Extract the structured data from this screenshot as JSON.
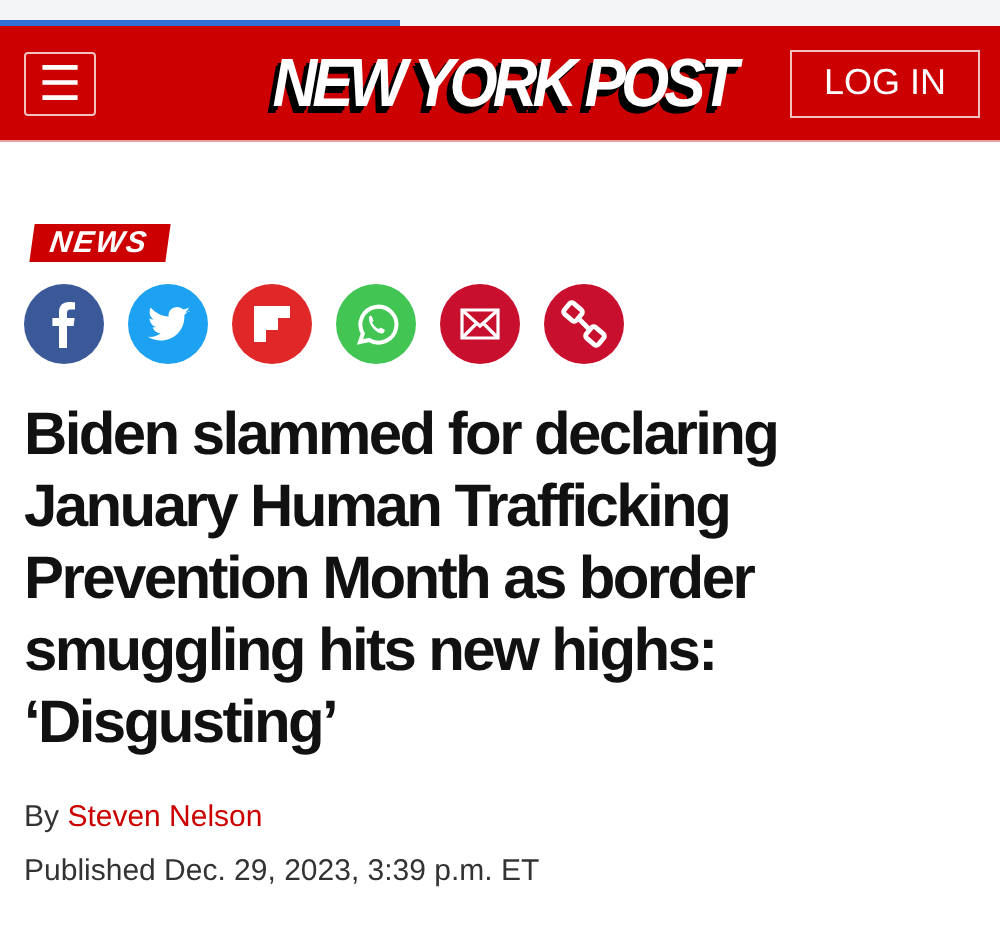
{
  "progress": {
    "level": 0.4
  },
  "header": {
    "menu_icon": "☰",
    "logo": "NEW YORK POST",
    "login": "LOG IN"
  },
  "section_tag": "NEWS",
  "share_buttons": [
    {
      "kind": "facebook",
      "color": "#3b5998"
    },
    {
      "kind": "twitter",
      "color": "#1da1f2"
    },
    {
      "kind": "flipboard",
      "color": "#e12828"
    },
    {
      "kind": "whatsapp",
      "color": "#43c553"
    },
    {
      "kind": "email",
      "color": "#c8102e"
    },
    {
      "kind": "link",
      "color": "#c8102e"
    }
  ],
  "headline": "Biden slammed for declaring January Human Trafficking Prevention Month as border smuggling hits new highs: ‘Disgusting’",
  "byline": {
    "prefix": "By",
    "author": "Steven Nelson"
  },
  "published": "Published Dec. 29, 2023, 3:39 p.m. ET"
}
